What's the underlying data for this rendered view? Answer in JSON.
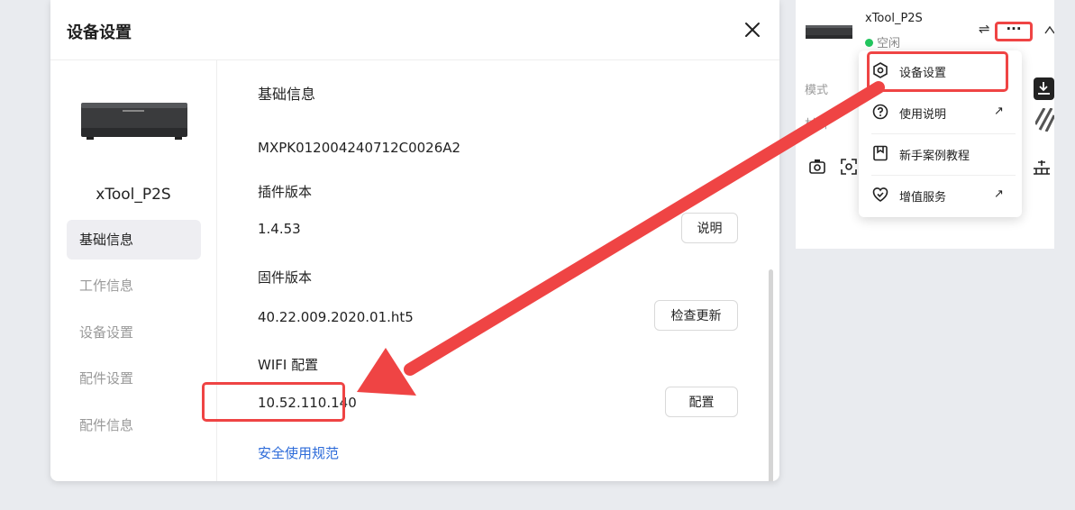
{
  "modal": {
    "title": "设备设置",
    "device_name": "xTool_P2S",
    "nav": [
      {
        "label": "基础信息",
        "active": true
      },
      {
        "label": "工作信息",
        "active": false
      },
      {
        "label": "设备设置",
        "active": false
      },
      {
        "label": "配件设置",
        "active": false
      },
      {
        "label": "配件信息",
        "active": false
      }
    ],
    "section_title": "基础信息",
    "serial": "MXPK012004240712C0026A2",
    "plugin": {
      "label": "插件版本",
      "value": "1.4.53",
      "button": "说明"
    },
    "firmware": {
      "label": "固件版本",
      "value": "40.22.009.2020.01.ht5",
      "button": "检查更新"
    },
    "wifi": {
      "label": "WIFI 配置",
      "value": "10.52.110.140",
      "button": "配置"
    },
    "safety_link": "安全使用规范"
  },
  "panel": {
    "device_name": "xTool_P2S",
    "status": "空闲",
    "status_color": "#22c55e",
    "more_label": "···",
    "label_mode": "模式",
    "label_material": "材料"
  },
  "dropdown": {
    "items": [
      {
        "label": "设备设置",
        "icon": "settings-hex-icon",
        "external": false
      },
      {
        "label": "使用说明",
        "icon": "help-circle-icon",
        "external": true
      },
      {
        "label": "新手案例教程",
        "icon": "bookmark-icon",
        "external": false
      },
      {
        "label": "增值服务",
        "icon": "check-shield-icon",
        "external": true
      }
    ],
    "arrow": "↗"
  },
  "colors": {
    "highlight": "#ef4444",
    "link": "#2d6bd9",
    "active_nav_bg": "#eeeef2"
  }
}
